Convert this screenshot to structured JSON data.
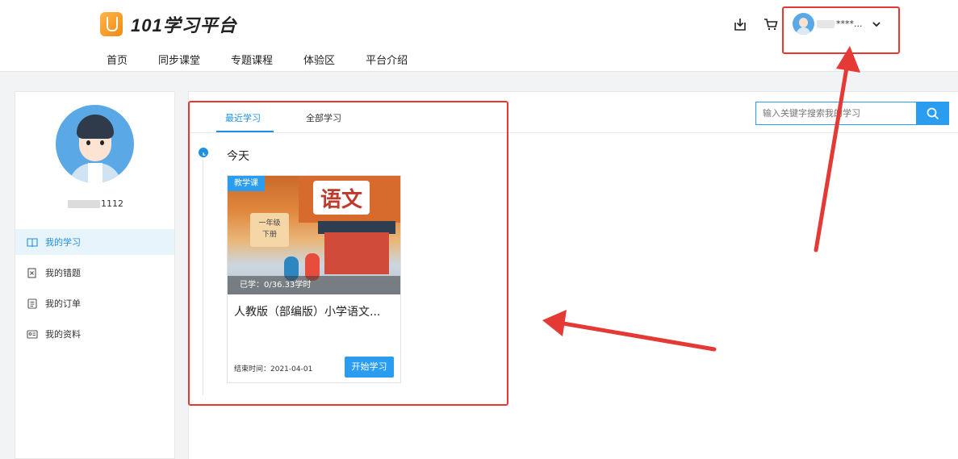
{
  "header": {
    "logo_text": "101学习平台",
    "nav": [
      "首页",
      "同步课堂",
      "专题课程",
      "体验区",
      "平台介绍"
    ],
    "user": {
      "name": "****...",
      "icons": [
        "download-icon",
        "cart-icon",
        "chevron-down-icon"
      ]
    }
  },
  "sidebar": {
    "user_id_suffix": "1112",
    "menu": [
      {
        "label": "我的学习",
        "icon": "book-icon",
        "active": true
      },
      {
        "label": "我的错题",
        "icon": "wrong-question-icon",
        "active": false
      },
      {
        "label": "我的订单",
        "icon": "order-icon",
        "active": false
      },
      {
        "label": "我的资料",
        "icon": "id-card-icon",
        "active": false
      }
    ]
  },
  "main": {
    "tabs": [
      {
        "label": "最近学习",
        "active": true
      },
      {
        "label": "全部学习",
        "active": false
      }
    ],
    "search": {
      "placeholder": "输入关键字搜索我的学习"
    },
    "timeline": {
      "day_label": "今天",
      "course": {
        "badge": "教学课",
        "progress": "已学：0/36.33学时",
        "cover_title": "语文",
        "cover_grade": "一年级",
        "cover_volume": "下册",
        "title": "人教版（部编版）小学语文...",
        "end_date": "结束时间：2021-04-01",
        "button": "开始学习"
      }
    }
  },
  "colors": {
    "accent": "#1e8fe1",
    "button": "#2b9df0",
    "annotation": "#e53935"
  }
}
